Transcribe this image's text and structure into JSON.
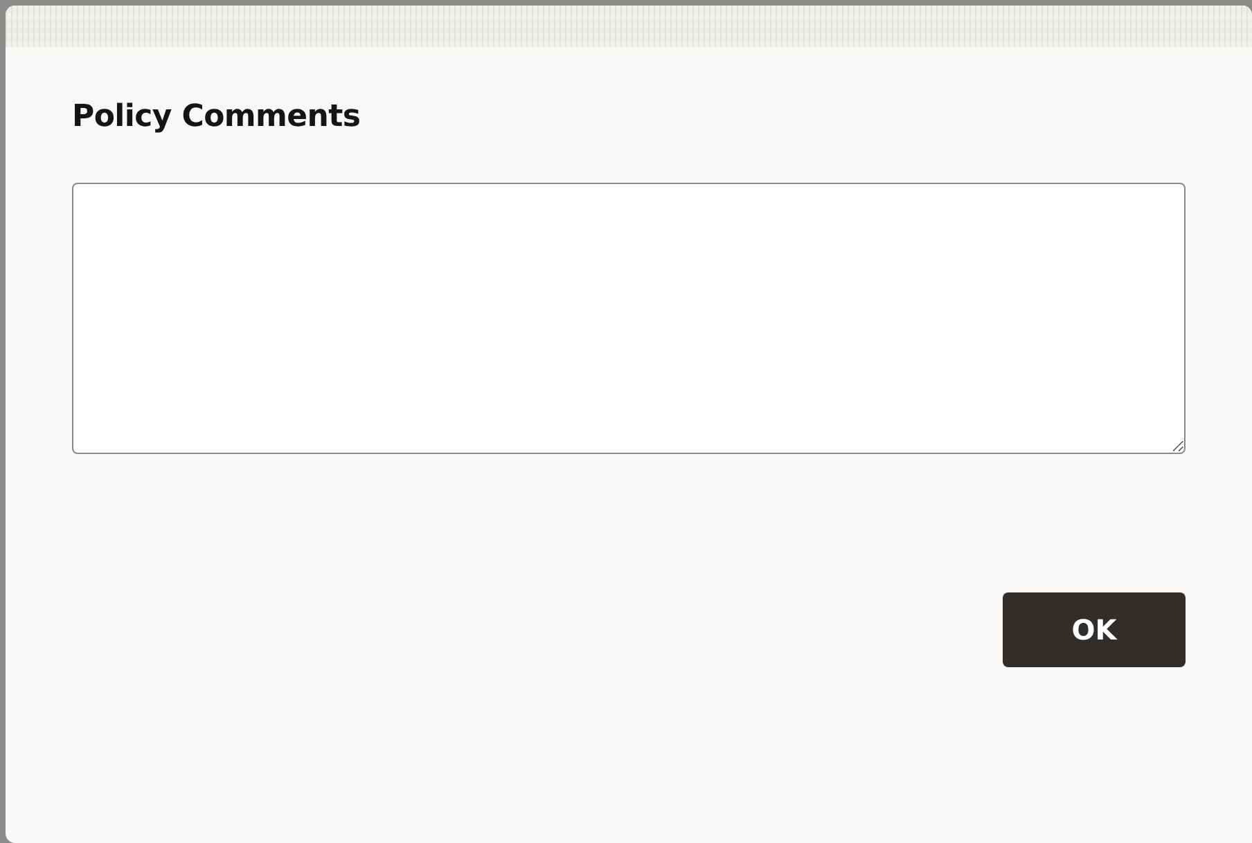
{
  "dialog": {
    "title": "Policy Comments"
  },
  "buttons": [
    {
      "label": "OK"
    }
  ]
}
